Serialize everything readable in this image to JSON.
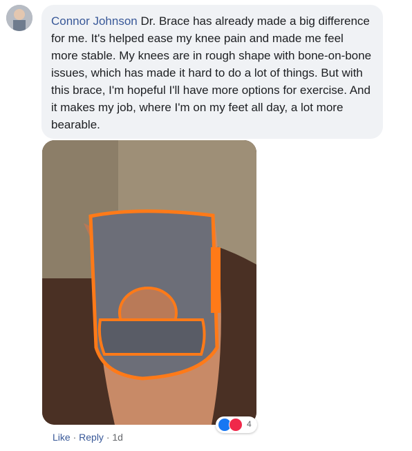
{
  "comment": {
    "author": "Connor Johnson",
    "text": "Dr. Brace has already made a big difference for me. It's helped ease my knee pain and made me feel more stable. My knees are in rough shape with bone-on-bone issues, which has made it hard to do a lot of things. But with this brace, I'm hopeful I'll have more options for exercise. And it makes my job, where I'm on my feet all day, a lot more bearable.",
    "avatar_icon": "user-avatar"
  },
  "photo": {
    "alt": "knee-brace-photo"
  },
  "reactions": {
    "icons": [
      "like-icon",
      "love-icon"
    ],
    "count": "4",
    "colors": {
      "like": "#1877f2",
      "love": "#f0284a"
    }
  },
  "actions": {
    "like_label": "Like",
    "separator": " · ",
    "reply_label": "Reply",
    "separator2": " · ",
    "time": "1d"
  },
  "colors": {
    "link": "#385898",
    "bubble": "#f0f2f5",
    "text": "#1c1e21",
    "muted": "#65676b"
  }
}
